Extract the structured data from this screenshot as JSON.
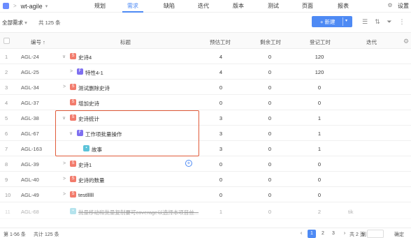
{
  "project": {
    "name": "wt-agile"
  },
  "nav": {
    "items": [
      {
        "label": "规划"
      },
      {
        "label": "需求",
        "active": true
      },
      {
        "label": "缺陷"
      },
      {
        "label": "迭代"
      },
      {
        "label": "版本"
      },
      {
        "label": "测试"
      },
      {
        "label": "页面"
      },
      {
        "label": "报表"
      }
    ],
    "settings_label": "设置"
  },
  "toolbar": {
    "filter_label": "全部需求",
    "total_label": "共 125 条",
    "new_button_label": "+ 新建"
  },
  "table": {
    "headers": {
      "key": "编号 ↑",
      "title": "标题",
      "estimate": "预估工时",
      "remaining": "剩余工时",
      "logged": "登记工时",
      "iteration": "迭代"
    },
    "rows": [
      {
        "idx": "1",
        "key": "AGL-24",
        "toggle": "∨",
        "type": "epic",
        "title": "史诗4",
        "estimate": "4",
        "remaining": "0",
        "logged": "120",
        "iteration": ""
      },
      {
        "idx": "2",
        "key": "AGL-25",
        "toggle": ">",
        "type": "feature",
        "title": "特性4-1",
        "estimate": "4",
        "remaining": "0",
        "logged": "120",
        "iteration": ""
      },
      {
        "idx": "3",
        "key": "AGL-34",
        "toggle": ">",
        "type": "epic",
        "title": "测试删除史诗",
        "estimate": "0",
        "remaining": "0",
        "logged": "0",
        "iteration": ""
      },
      {
        "idx": "4",
        "key": "AGL-37",
        "toggle": "",
        "type": "epic",
        "title": "增加史诗",
        "estimate": "0",
        "remaining": "0",
        "logged": "0",
        "iteration": ""
      },
      {
        "idx": "5",
        "key": "AGL-38",
        "toggle": "∨",
        "type": "epic",
        "title": "史诗统计",
        "estimate": "3",
        "remaining": "0",
        "logged": "1",
        "iteration": ""
      },
      {
        "idx": "6",
        "key": "AGL-67",
        "toggle": "∨",
        "type": "feature",
        "title": "工作项批量操作",
        "estimate": "3",
        "remaining": "0",
        "logged": "1",
        "iteration": ""
      },
      {
        "idx": "7",
        "key": "AGL-163",
        "toggle": "",
        "type": "story",
        "title": "故事",
        "estimate": "3",
        "remaining": "0",
        "logged": "1",
        "iteration": ""
      },
      {
        "idx": "8",
        "key": "AGL-39",
        "toggle": ">",
        "type": "epic",
        "title": "史诗1",
        "estimate": "0",
        "remaining": "0",
        "logged": "0",
        "iteration": ""
      },
      {
        "idx": "9",
        "key": "AGL-40",
        "toggle": ">",
        "type": "epic",
        "title": "史诗的数量",
        "estimate": "0",
        "remaining": "0",
        "logged": "0",
        "iteration": ""
      },
      {
        "idx": "10",
        "key": "AGL-49",
        "toggle": ">",
        "type": "epic",
        "title": "testllllll",
        "estimate": "0",
        "remaining": "0",
        "logged": "0",
        "iteration": ""
      },
      {
        "idx": "11",
        "key": "AGL-68",
        "toggle": "",
        "type": "story",
        "title": "批量移动和批量复制要可coverage以选择本项目丝...",
        "estimate": "1",
        "remaining": "0",
        "logged": "2",
        "iteration": "tik"
      }
    ]
  },
  "footer": {
    "range_label": "第 1-56 条",
    "total_label": "共计 125 条",
    "pages": [
      "1",
      "2",
      "3"
    ],
    "active_page": "1",
    "page_count_label": "共 2 页",
    "goto_label": "到",
    "confirm_label": "确定"
  }
}
